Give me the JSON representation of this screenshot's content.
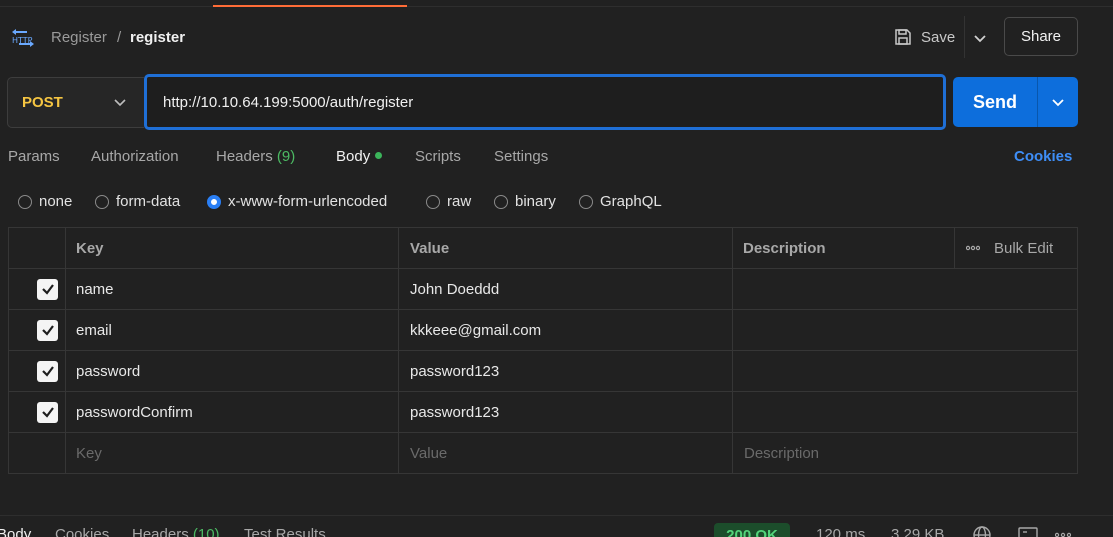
{
  "header": {
    "breadcrumb_parent": "Register",
    "breadcrumb_separator": "/",
    "breadcrumb_current": "register",
    "save_label": "Save",
    "share_label": "Share"
  },
  "request": {
    "method": "POST",
    "url": "http://10.10.64.199:5000/auth/register",
    "send_label": "Send"
  },
  "tabs": {
    "params": "Params",
    "authorization": "Authorization",
    "headers": "Headers",
    "headers_count": "(9)",
    "body": "Body",
    "scripts": "Scripts",
    "settings": "Settings",
    "cookies": "Cookies"
  },
  "body_types": {
    "none": "none",
    "form_data": "form-data",
    "urlencoded": "x-www-form-urlencoded",
    "raw": "raw",
    "binary": "binary",
    "graphql": "GraphQL",
    "selected": "x-www-form-urlencoded"
  },
  "table": {
    "col_key": "Key",
    "col_value": "Value",
    "col_description": "Description",
    "bulk_edit": "Bulk Edit",
    "rows": [
      {
        "key": "name",
        "value": "John Doeddd",
        "description": "",
        "checked": true
      },
      {
        "key": "email",
        "value": "kkkeee@gmail.com",
        "description": "",
        "checked": true
      },
      {
        "key": "password",
        "value": "password123",
        "description": "",
        "checked": true
      },
      {
        "key": "passwordConfirm",
        "value": "password123",
        "description": "",
        "checked": true
      }
    ],
    "placeholder_key": "Key",
    "placeholder_value": "Value",
    "placeholder_description": "Description"
  },
  "response_bar": {
    "body": "Body",
    "cookies": "Cookies",
    "headers": "Headers",
    "headers_count": "(10)",
    "test_results": "Test Results",
    "status": "200 OK",
    "time": "120 ms",
    "size": "3.29 KB"
  },
  "colors": {
    "accent_send": "#0d6edc",
    "method_post": "#f5c542",
    "cookies_link": "#3e8ef7",
    "status_ok": "#53d47a"
  }
}
